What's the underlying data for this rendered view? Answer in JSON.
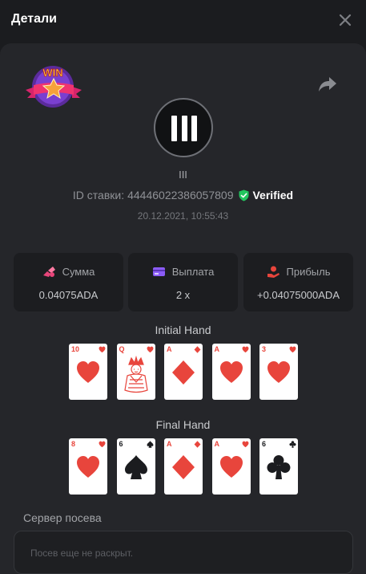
{
  "header": {
    "title": "Детали",
    "close_icon": "close-icon"
  },
  "badge": {
    "text": "WIN",
    "icon": "win-star-badge"
  },
  "share_icon": "share-arrow-icon",
  "game": {
    "name": "III",
    "icon": "three-bars-icon"
  },
  "bet": {
    "id_label": "ID ставки:",
    "id_value": "44446022386057809",
    "verified": "Verified",
    "date": "20.12.2021, 10:55:43"
  },
  "stats": [
    {
      "label": "Сумма",
      "value": "0.04075ADA",
      "icon": "coin-stack-icon",
      "color": "#e8457a"
    },
    {
      "label": "Выплата",
      "value": "2 x",
      "icon": "card-payout-icon",
      "color": "#8b5cf6"
    },
    {
      "label": "Прибыль",
      "value": "+0.04075000ADA",
      "icon": "profit-hand-icon",
      "color": "#e8453c"
    }
  ],
  "initial_hand": {
    "title": "Initial Hand",
    "cards": [
      {
        "rank": "10",
        "suit": "hearts"
      },
      {
        "rank": "Q",
        "suit": "hearts"
      },
      {
        "rank": "A",
        "suit": "diamonds"
      },
      {
        "rank": "A",
        "suit": "hearts"
      },
      {
        "rank": "3",
        "suit": "hearts"
      }
    ]
  },
  "final_hand": {
    "title": "Final Hand",
    "cards": [
      {
        "rank": "8",
        "suit": "hearts"
      },
      {
        "rank": "6",
        "suit": "spades"
      },
      {
        "rank": "A",
        "suit": "diamonds"
      },
      {
        "rank": "A",
        "suit": "hearts"
      },
      {
        "rank": "6",
        "suit": "clubs"
      }
    ]
  },
  "seed": {
    "label": "Сервер посева",
    "placeholder": "Посев еще не раскрыт."
  },
  "colors": {
    "background": "#1b1c1f",
    "panel": "#25262a",
    "verified": "#22c55e",
    "red_suit": "#e8453c"
  }
}
